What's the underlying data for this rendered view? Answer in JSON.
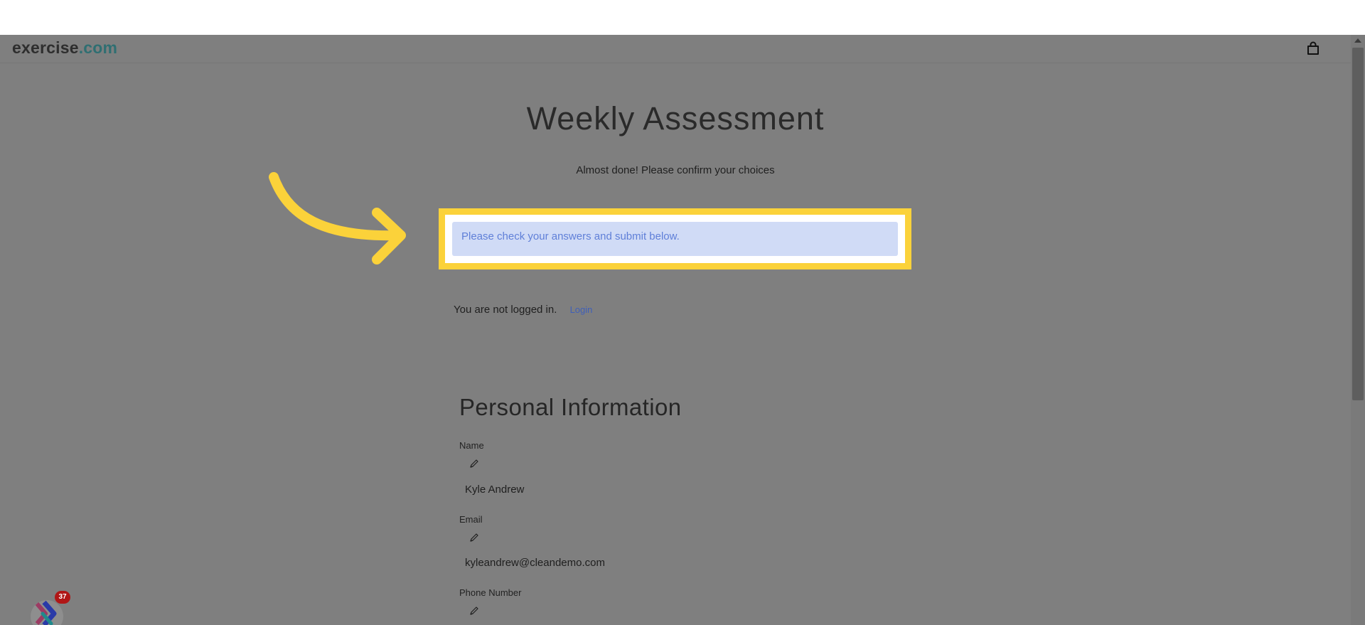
{
  "header": {
    "logo_main": "exercise",
    "logo_tld": ".com",
    "cart_icon": "shopping-bag-icon"
  },
  "page": {
    "title": "Weekly Assessment",
    "subtitle": "Almost done! Please confirm your choices"
  },
  "alert": {
    "text": "Please check your answers and submit below."
  },
  "auth": {
    "status_text": "You are not logged in.",
    "login_link": "Login"
  },
  "personal_info": {
    "heading": "Personal Information",
    "fields": [
      {
        "label": "Name",
        "value": "Kyle Andrew"
      },
      {
        "label": "Email",
        "value": "kyleandrew@cleandemo.com"
      },
      {
        "label": "Phone Number",
        "value": ""
      }
    ]
  },
  "launcher": {
    "badge_count": "37"
  },
  "colors": {
    "highlight": "#fbd23a",
    "alert_bg": "#d0dbf6",
    "alert_text": "#5f7fd8",
    "overlay": "#7f7f7f",
    "logo_tld": "#2f6f72"
  }
}
